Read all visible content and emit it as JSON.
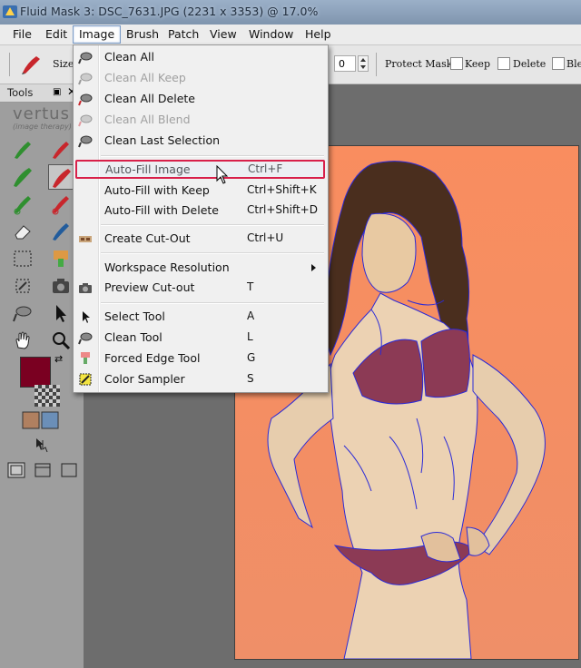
{
  "window": {
    "title": "Fluid Mask 3: DSC_7631.JPG (2231 x 3353) @ 17.0%"
  },
  "menubar": {
    "items": [
      "File",
      "Edit",
      "Image",
      "Brush",
      "Patch",
      "View",
      "Window",
      "Help"
    ],
    "active": "Image"
  },
  "toolbar": {
    "size_label": "Size",
    "number_value": "0",
    "protect_mask_label": "Protect Mask:",
    "keep_label": "Keep",
    "delete_label": "Delete",
    "blend_label": "Ble"
  },
  "tools_panel": {
    "title": "Tools",
    "pin_icon": "pin-icon",
    "close_icon": "close-icon",
    "logo_text": "vertus",
    "logo_subtext": "(image therapy)",
    "foreground_color": "#7a0021"
  },
  "image_menu": {
    "items": [
      {
        "label": "Clean All",
        "shortcut": "",
        "disabled": false,
        "icon": "clean-brush-icon"
      },
      {
        "label": "Clean All Keep",
        "shortcut": "",
        "disabled": true,
        "icon": "clean-keep-icon"
      },
      {
        "label": "Clean All Delete",
        "shortcut": "",
        "disabled": false,
        "icon": "clean-delete-icon"
      },
      {
        "label": "Clean All Blend",
        "shortcut": "",
        "disabled": true,
        "icon": "clean-blend-icon"
      },
      {
        "label": "Clean Last Selection",
        "shortcut": "",
        "disabled": false,
        "icon": "clean-last-icon"
      },
      {
        "label": "Auto-Fill Image",
        "shortcut": "Ctrl+F",
        "disabled": false,
        "highlighted": true
      },
      {
        "label": "Auto-Fill with Keep",
        "shortcut": "Ctrl+Shift+K",
        "disabled": false
      },
      {
        "label": "Auto-Fill with Delete",
        "shortcut": "Ctrl+Shift+D",
        "disabled": false
      },
      {
        "label": "Create Cut-Out",
        "shortcut": "Ctrl+U",
        "disabled": false,
        "icon": "cutout-icon"
      },
      {
        "label": "Workspace Resolution",
        "shortcut": "",
        "disabled": false,
        "submenu": true
      },
      {
        "label": "Preview Cut-out",
        "shortcut": "T",
        "disabled": false,
        "icon": "camera-icon"
      },
      {
        "label": "Select Tool",
        "shortcut": "A",
        "disabled": false,
        "icon": "arrow-pointer-icon"
      },
      {
        "label": "Clean Tool",
        "shortcut": "L",
        "disabled": false,
        "icon": "clean-tool-icon"
      },
      {
        "label": "Forced Edge Tool",
        "shortcut": "G",
        "disabled": false,
        "icon": "forced-edge-icon"
      },
      {
        "label": "Color Sampler",
        "shortcut": "S",
        "disabled": false,
        "icon": "color-sampler-icon"
      }
    ]
  },
  "colors": {
    "menu_highlight_border": "#d8204a",
    "canvas_background": "#f98d5f",
    "edge_lines": "#2a2ad8"
  }
}
